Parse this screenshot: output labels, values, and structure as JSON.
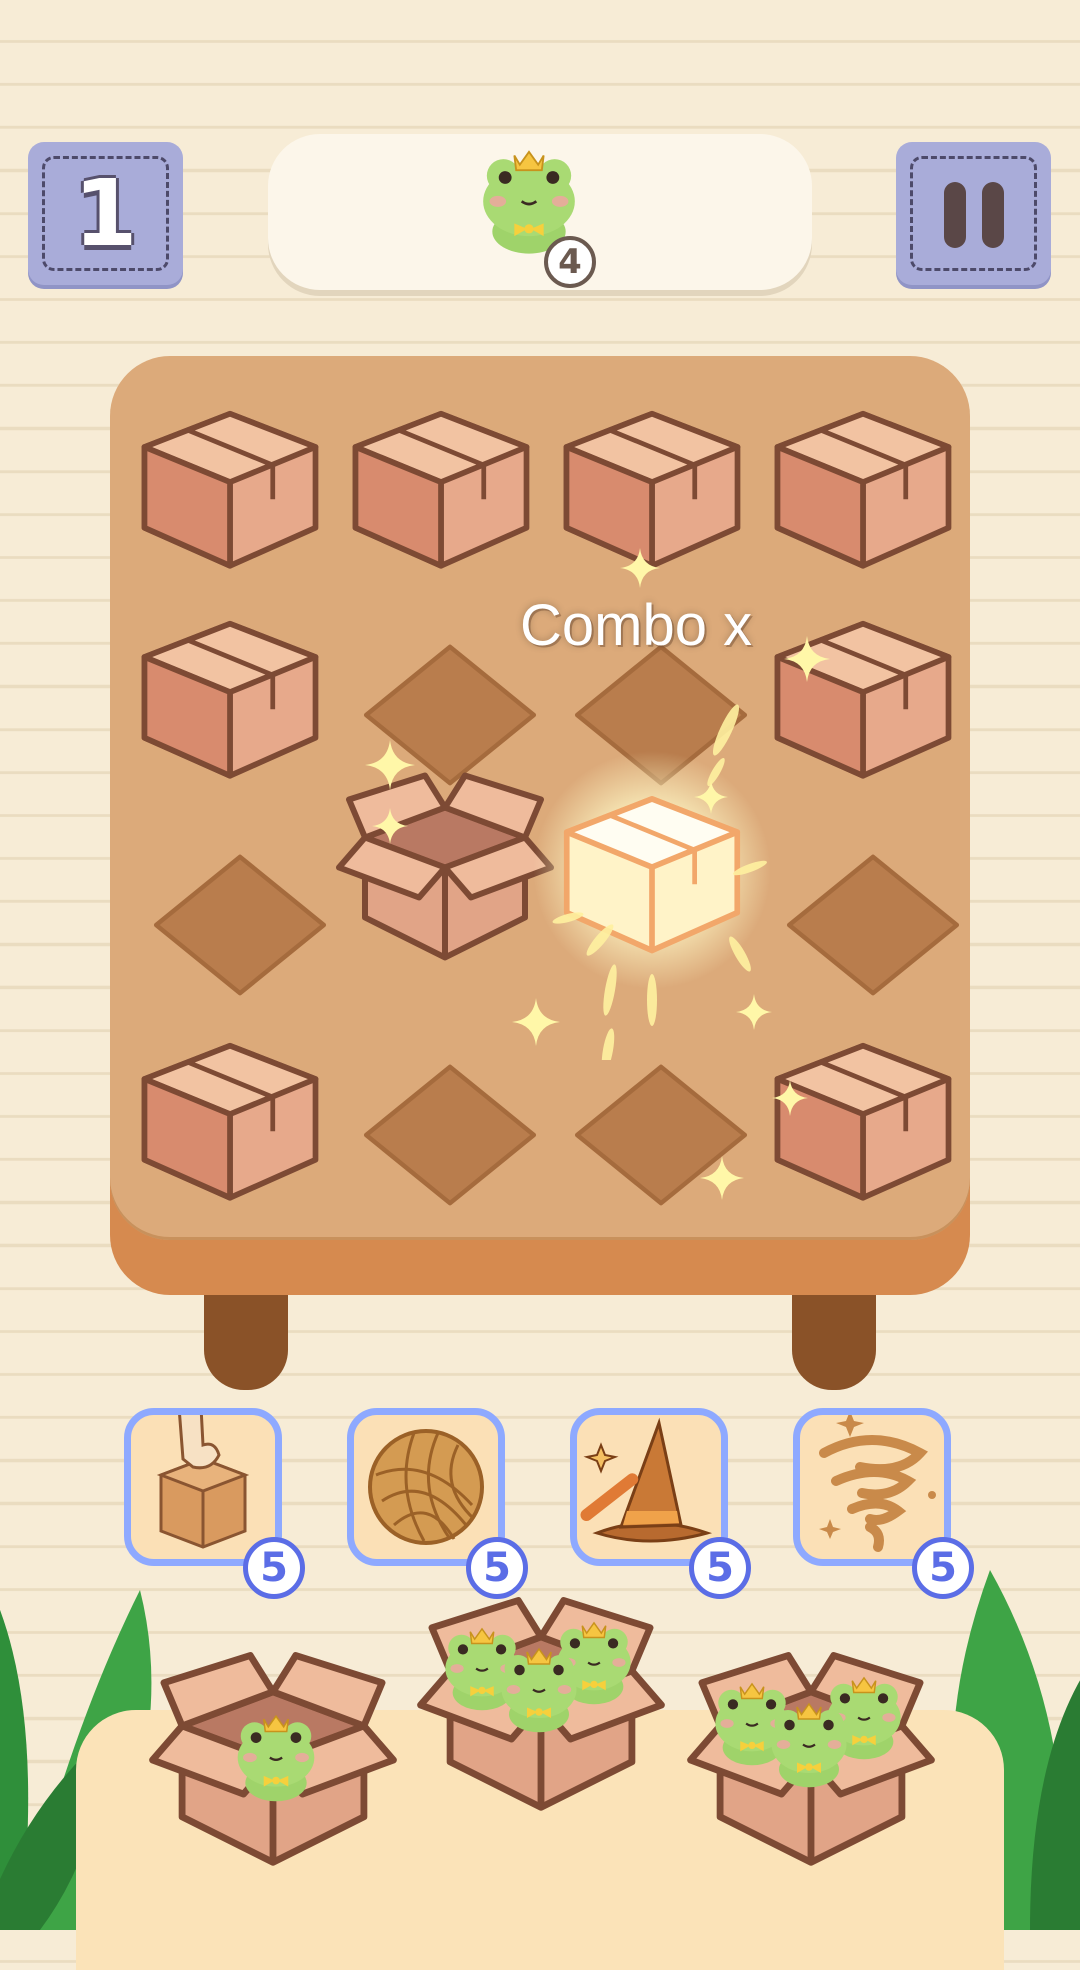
{
  "header": {
    "level": "1",
    "goal_count": "4",
    "goal_icon": "frog-prince-icon",
    "pause_icon": "pause-icon"
  },
  "board": {
    "combo_text": "Combo x",
    "grid": [
      [
        "box",
        "box",
        "box",
        "box"
      ],
      [
        "box",
        "empty",
        "empty",
        "box"
      ],
      [
        "empty",
        "open-box",
        "glowing-box",
        "empty"
      ],
      [
        "box",
        "empty",
        "empty",
        "box"
      ]
    ]
  },
  "boosters": [
    {
      "icon": "tap-box-icon",
      "count": "5"
    },
    {
      "icon": "yarn-ball-icon",
      "count": "5"
    },
    {
      "icon": "wizard-hat-icon",
      "count": "5"
    },
    {
      "icon": "tornado-icon",
      "count": "5"
    }
  ],
  "tray": [
    {
      "icon": "open-box-icon",
      "frogs": 1
    },
    {
      "icon": "open-box-icon",
      "frogs": 3
    },
    {
      "icon": "open-box-icon",
      "frogs": 3
    }
  ],
  "colors": {
    "board": "#dcaa7a",
    "booster_border": "#8ea9ff",
    "button": "#a9acd9"
  }
}
